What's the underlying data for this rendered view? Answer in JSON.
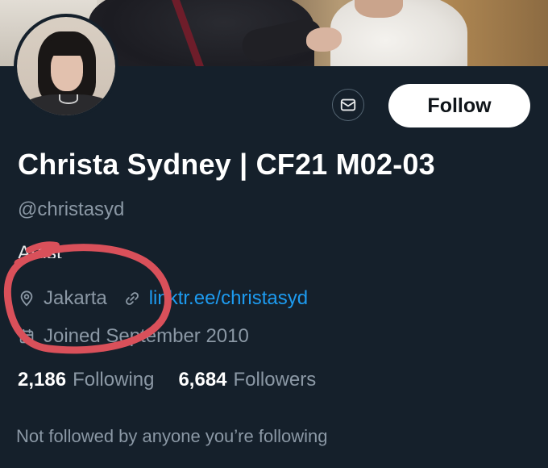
{
  "banner": {
    "image": "header-photo"
  },
  "profile": {
    "avatar": "profile-avatar",
    "display_name": "Christa Sydney | CF21 M02-03",
    "handle": "@christasyd",
    "bio": "Artist",
    "location": "Jakarta",
    "website": "linktr.ee/christasyd",
    "joined": "Joined September 2010",
    "following_count": "2,186",
    "following_label": "Following",
    "followers_count": "6,684",
    "followers_label": "Followers",
    "mutuals_note": "Not followed by anyone you’re following"
  },
  "actions": {
    "message_icon": "envelope-icon",
    "follow_label": "Follow"
  },
  "icons": {
    "location": "map-pin-icon",
    "link": "link-icon",
    "calendar": "calendar-icon"
  },
  "annotation": {
    "color": "#d9505a",
    "shape": "hand-drawn red circle around location"
  },
  "colors": {
    "background": "#15202b",
    "text_primary": "#ffffff",
    "text_secondary": "#8b98a5",
    "link": "#1d9bf0",
    "follow_button_bg": "#ffffff"
  }
}
